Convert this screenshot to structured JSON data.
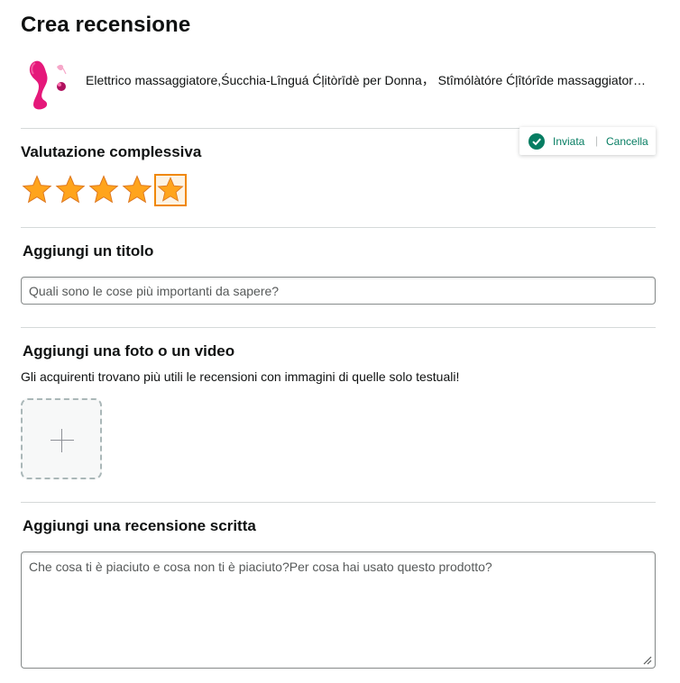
{
  "page": {
    "title": "Crea recensione"
  },
  "product": {
    "name": "Elettrico massaggiatore,Śucchia-Lînguá Ćļitòrīdè per Donna， Stîmólàtóre Ćļîtórîde massaggiatore ricaricabile",
    "image_icon": "pink-product-icon"
  },
  "toast": {
    "status": "Inviata",
    "separator": "|",
    "cancel_label": "Cancella",
    "status_color": "#067d62",
    "icon": "check-circle-icon"
  },
  "rating": {
    "heading": "Valutazione complessiva",
    "max": 5,
    "filled": 5,
    "selected_index": 5,
    "star_color": "#ffa41c",
    "selected_border_color": "#f08804"
  },
  "title_section": {
    "heading": "Aggiungi un titolo",
    "placeholder": "Quali sono le cose più importanti da sapere?",
    "value": ""
  },
  "media_section": {
    "heading": "Aggiungi una foto o un video",
    "helper": "Gli acquirenti trovano più utili le recensioni con immagini di quelle solo testuali!",
    "upload_icon": "plus-icon"
  },
  "review_section": {
    "heading": "Aggiungi una recensione scritta",
    "placeholder": "Che cosa ti è piaciuto e cosa non ti è piaciuto?Per cosa hai usato questo prodotto?",
    "value": ""
  }
}
